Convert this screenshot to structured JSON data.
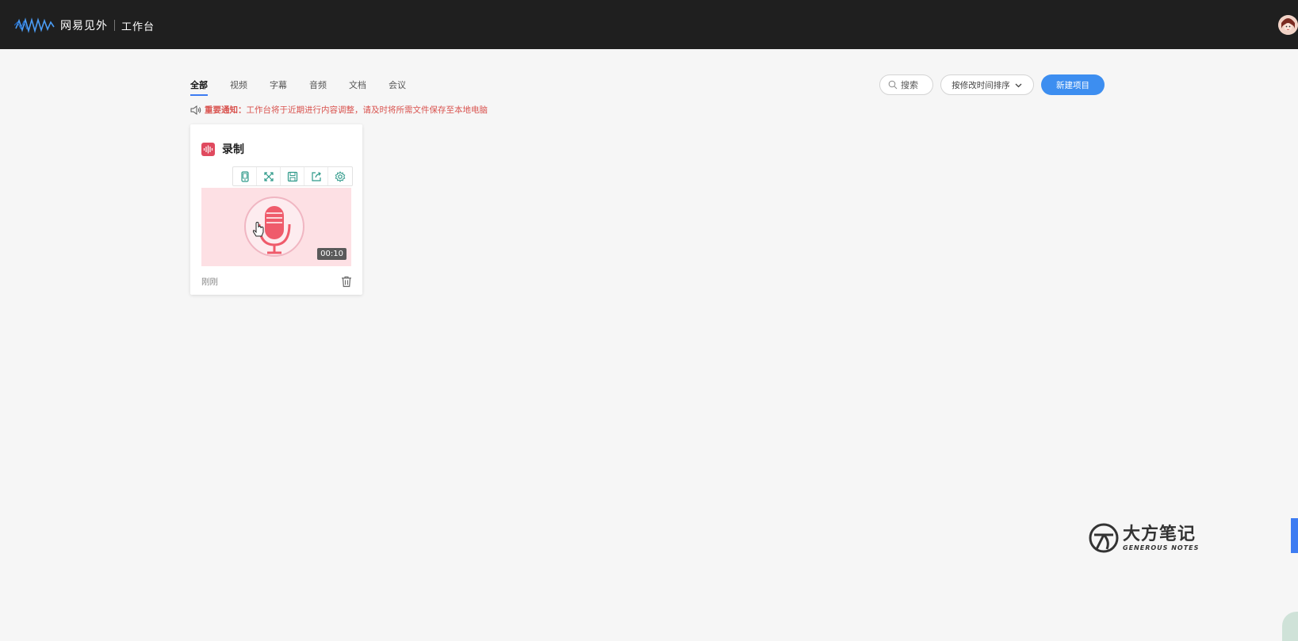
{
  "header": {
    "brand_name": "网易见外",
    "brand_sub": "工作台"
  },
  "tabs": [
    {
      "label": "全部",
      "active": true
    },
    {
      "label": "视频",
      "active": false
    },
    {
      "label": "字幕",
      "active": false
    },
    {
      "label": "音频",
      "active": false
    },
    {
      "label": "文档",
      "active": false
    },
    {
      "label": "会议",
      "active": false
    }
  ],
  "notice": {
    "title": "重要通知：",
    "text": "工作台将于近期进行内容调整，请及时将所需文件保存至本地电脑"
  },
  "controls": {
    "search_label": "搜索",
    "sort_label": "按修改时间排序",
    "new_project_label": "新建项目"
  },
  "project_card": {
    "title": "录制",
    "duration": "00:10",
    "time": "刚刚",
    "toolbar_icons": [
      "phone-icon",
      "expand-icon",
      "save-icon",
      "export-icon",
      "settings-icon"
    ]
  },
  "watermark": {
    "cn": "大方笔记",
    "en": "GENEROUS NOTES"
  },
  "colors": {
    "topbar": "#1f1f1f",
    "accent": "#3d8ef0",
    "notice": "#d9534f",
    "record_red": "#e04a5f",
    "thumb_bg": "#fde0e4"
  }
}
